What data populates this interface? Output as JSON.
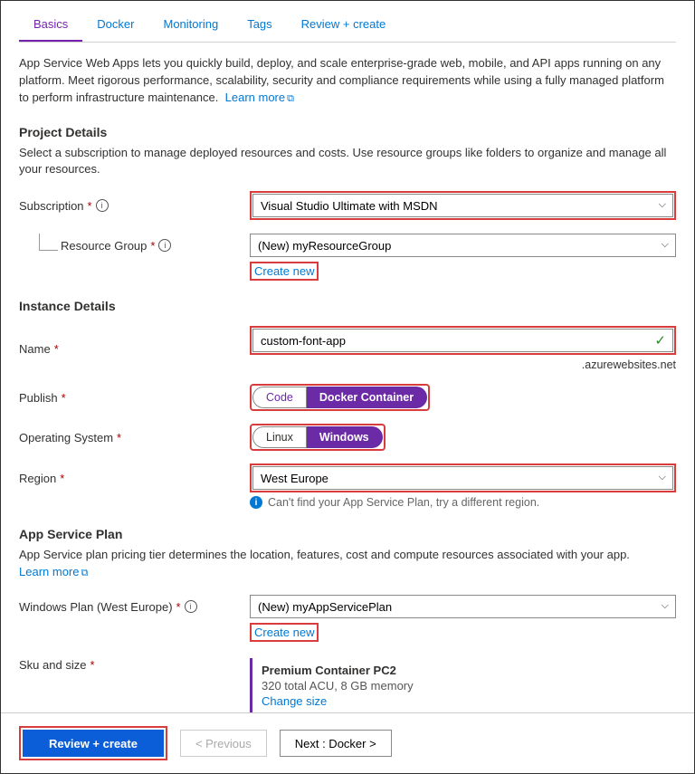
{
  "tabs": {
    "basics": "Basics",
    "docker": "Docker",
    "monitoring": "Monitoring",
    "tags": "Tags",
    "review": "Review + create"
  },
  "intro": "App Service Web Apps lets you quickly build, deploy, and scale enterprise-grade web, mobile, and API apps running on any platform. Meet rigorous performance, scalability, security and compliance requirements while using a fully managed platform to perform infrastructure maintenance.",
  "learn_more": "Learn more",
  "project": {
    "heading": "Project Details",
    "desc": "Select a subscription to manage deployed resources and costs. Use resource groups like folders to organize and manage all your resources.",
    "subscription_label": "Subscription",
    "subscription_value": "Visual Studio Ultimate with MSDN",
    "rg_label": "Resource Group",
    "rg_value": "(New) myResourceGroup",
    "create_new": "Create new"
  },
  "instance": {
    "heading": "Instance Details",
    "name_label": "Name",
    "name_value": "custom-font-app",
    "suffix": ".azurewebsites.net",
    "publish_label": "Publish",
    "publish_code": "Code",
    "publish_docker": "Docker Container",
    "os_label": "Operating System",
    "os_linux": "Linux",
    "os_windows": "Windows",
    "region_label": "Region",
    "region_value": "West Europe",
    "region_hint": "Can't find your App Service Plan, try a different region."
  },
  "plan": {
    "heading": "App Service Plan",
    "desc": "App Service plan pricing tier determines the location, features, cost and compute resources associated with your app.",
    "plan_label": "Windows Plan (West Europe)",
    "plan_value": "(New) myAppServicePlan",
    "create_new": "Create new",
    "sku_label": "Sku and size",
    "sku_title": "Premium Container PC2",
    "sku_sub": "320 total ACU, 8 GB memory",
    "change_size": "Change size"
  },
  "footer": {
    "review": "Review + create",
    "previous": "< Previous",
    "next": "Next : Docker >"
  }
}
